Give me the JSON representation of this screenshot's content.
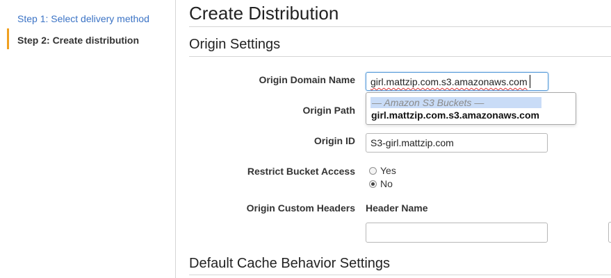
{
  "sidebar": {
    "steps": [
      {
        "label": "Step 1: Select delivery method",
        "active": false
      },
      {
        "label": "Step 2: Create distribution",
        "active": true
      }
    ]
  },
  "main": {
    "title": "Create Distribution",
    "origin_section": {
      "title": "Origin Settings",
      "origin_domain_name": {
        "label": "Origin Domain Name",
        "value": "girl.mattzip.com.s3.amazonaws.com"
      },
      "dropdown": {
        "group_header": "— Amazon S3 Buckets —",
        "options": [
          "girl.mattzip.com.s3.amazonaws.com"
        ]
      },
      "origin_path": {
        "label": "Origin Path"
      },
      "origin_id": {
        "label": "Origin ID",
        "value": "S3-girl.mattzip.com"
      },
      "restrict_bucket_access": {
        "label": "Restrict Bucket Access",
        "options": [
          "Yes",
          "No"
        ],
        "selected": "No"
      },
      "origin_custom_headers": {
        "label": "Origin Custom Headers",
        "header_name_label": "Header Name",
        "header_name_value": ""
      }
    },
    "cache_section": {
      "title": "Default Cache Behavior Settings"
    }
  },
  "colors": {
    "link": "#3b73c5",
    "active_step_bar": "#f0a020",
    "dropdown_highlight": "#c9dcf7",
    "focus_border": "#5b9dd9"
  }
}
